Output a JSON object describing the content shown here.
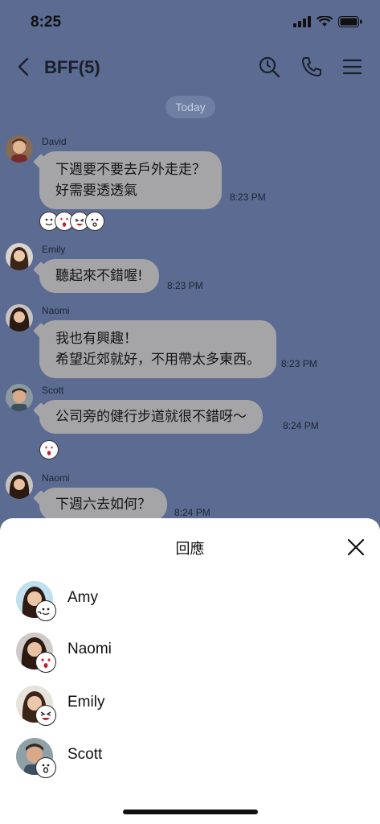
{
  "status": {
    "time": "8:25"
  },
  "nav": {
    "title": "BFF(5)"
  },
  "date_chip": "Today",
  "messages": [
    {
      "sender": "David",
      "lines": [
        "下週要不要去戶外走走？",
        "好需要透透氣"
      ],
      "time": "8:23 PM"
    },
    {
      "sender": "Emily",
      "lines": [
        "聽起來不錯喔!"
      ],
      "time": "8:23 PM"
    },
    {
      "sender": "Naomi",
      "lines": [
        "我也有興趣！",
        "希望近郊就好，不用帶太多東西。"
      ],
      "time": "8:23 PM"
    },
    {
      "sender": "Scott",
      "lines": [
        "公司旁的健行步道就很不錯呀～"
      ],
      "time": "8:24 PM"
    },
    {
      "sender": "Naomi",
      "lines": [
        "下週六去如何？"
      ],
      "time": "8:24 PM"
    }
  ],
  "sheet": {
    "title": "回應",
    "rows": [
      {
        "name": "Amy",
        "reaction_icon": "thumbs-up-face-icon"
      },
      {
        "name": "Naomi",
        "reaction_icon": "heart-eyes-face-icon"
      },
      {
        "name": "Emily",
        "reaction_icon": "laughing-face-icon"
      },
      {
        "name": "Scott",
        "reaction_icon": "surprised-face-icon"
      }
    ]
  }
}
